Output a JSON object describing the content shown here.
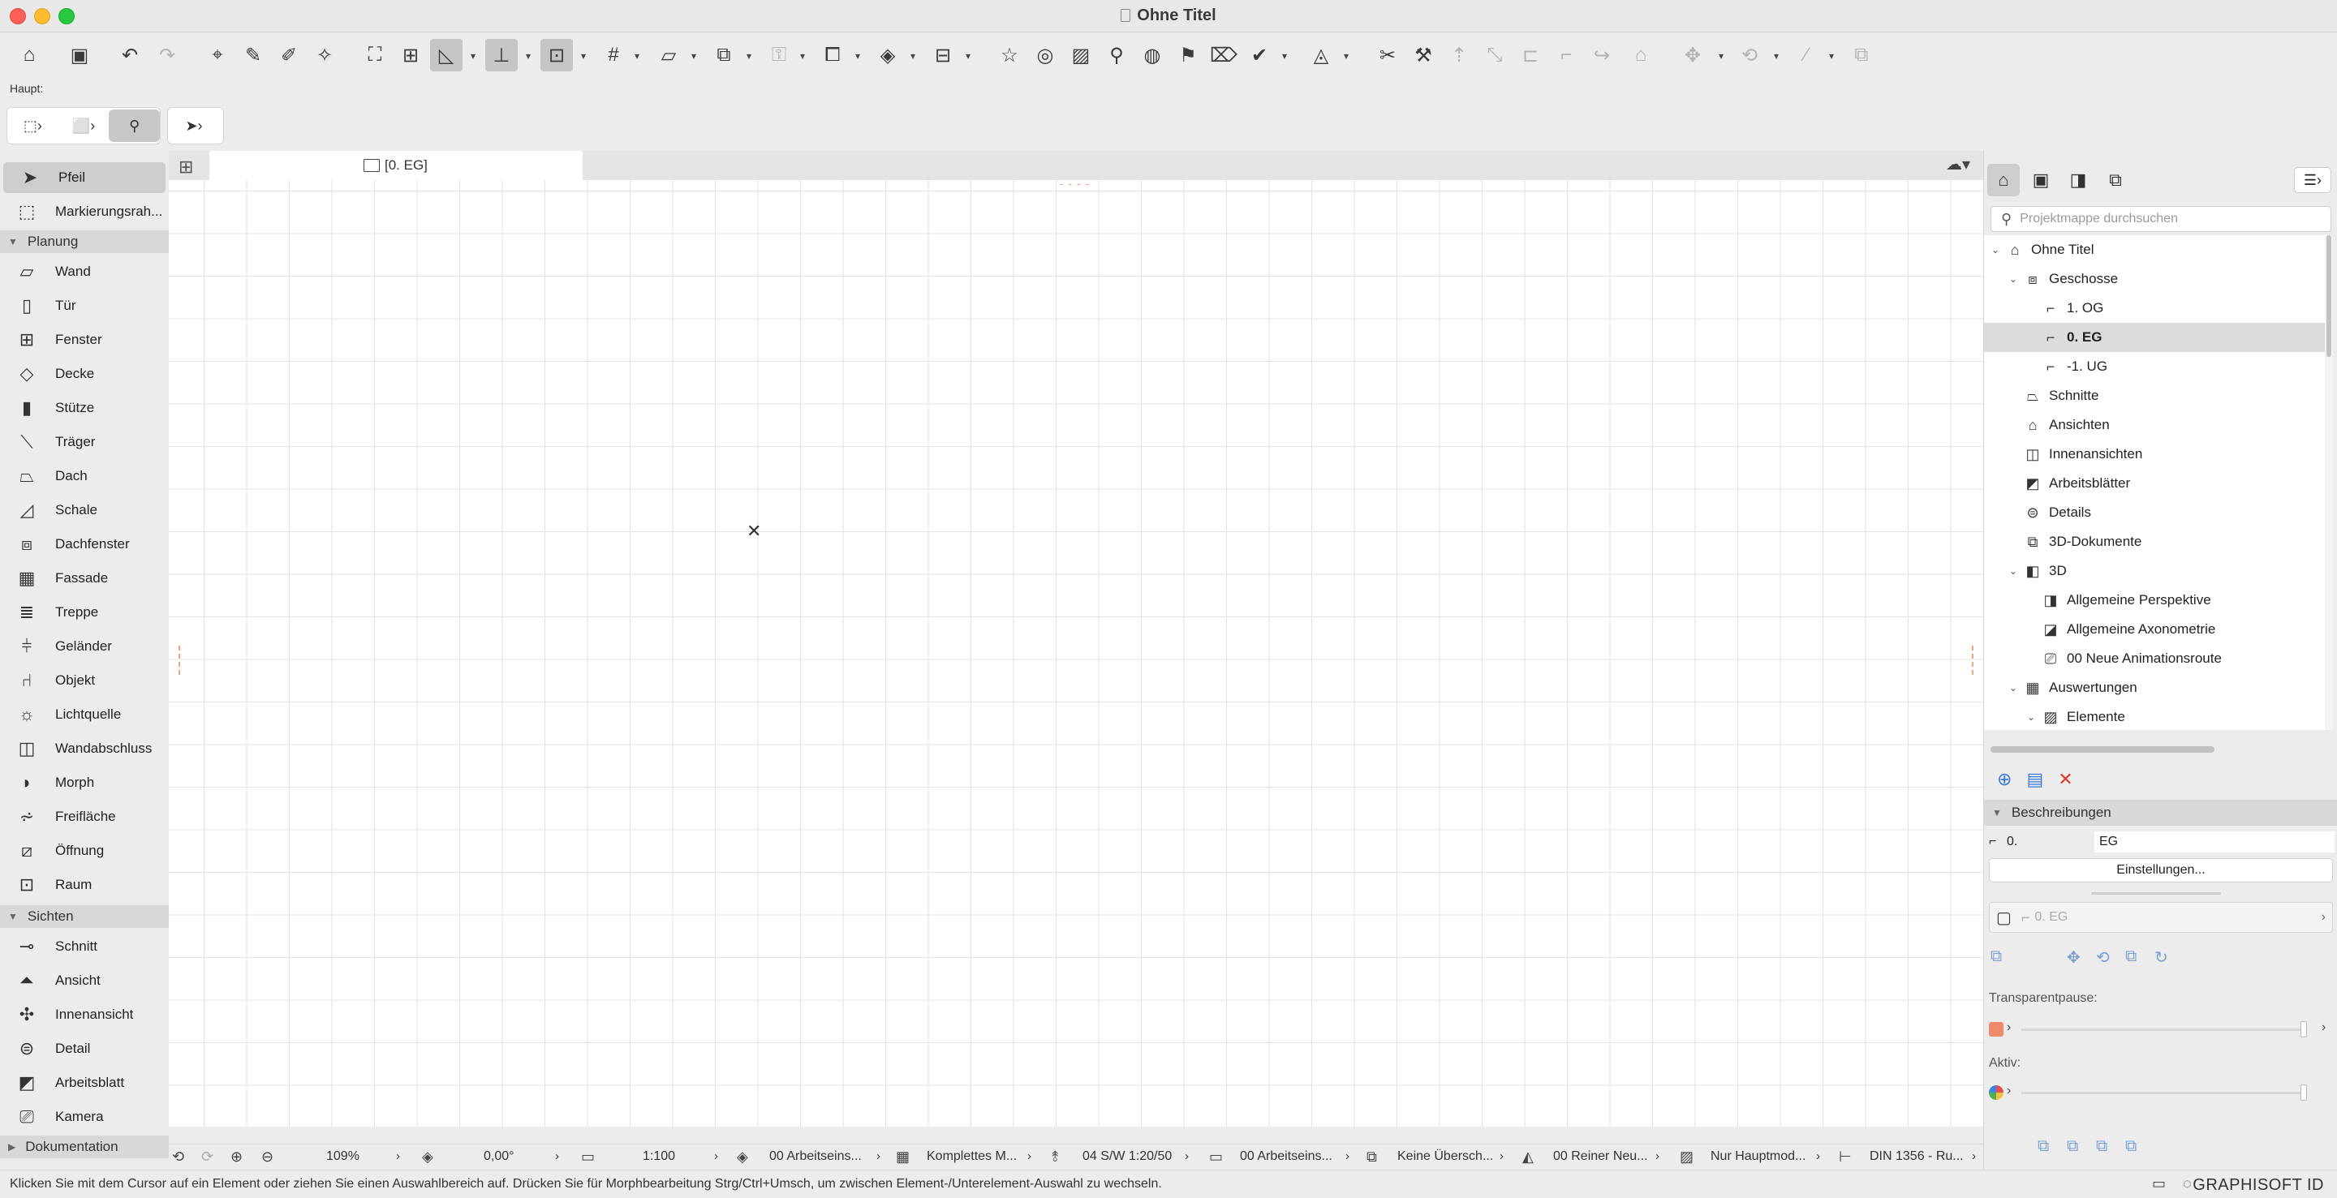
{
  "window": {
    "title": "Ohne Titel"
  },
  "toolbar": {
    "haupt_label": "Haupt:"
  },
  "toolbox": {
    "arrow": "Pfeil",
    "marquee": "Markierungsrah...",
    "sections": {
      "planung": "Planung",
      "sichten": "Sichten",
      "dokumentation": "Dokumentation"
    },
    "planung_tools": [
      "Wand",
      "Tür",
      "Fenster",
      "Decke",
      "Stütze",
      "Träger",
      "Dach",
      "Schale",
      "Dachfenster",
      "Fassade",
      "Treppe",
      "Geländer",
      "Objekt",
      "Lichtquelle",
      "Wandabschluss",
      "Morph",
      "Freifläche",
      "Öffnung",
      "Raum"
    ],
    "sichten_tools": [
      "Schnitt",
      "Ansicht",
      "Innenansicht",
      "Detail",
      "Arbeitsblatt",
      "Kamera"
    ]
  },
  "canvas": {
    "tab_label": "[0. EG]"
  },
  "controlbar": {
    "zoom": "109%",
    "angle": "0,00°",
    "scale": "1:100",
    "layer_combo": "00 Arbeitseins...",
    "model_view": "Komplettes M...",
    "pen_set": "04 S/W 1:20/50",
    "layer_combo2": "00 Arbeitseins...",
    "override": "Keine Übersch...",
    "renovation": "00 Reiner Neu...",
    "structure": "Nur Hauptmod...",
    "dimension": "DIN 1356 - Ru..."
  },
  "statusbar": {
    "message": "Klicken Sie mit dem Cursor auf ein Element oder ziehen Sie einen Auswahlbereich auf. Drücken Sie für Morphbearbeitung Strg/Ctrl+Umsch, um zwischen Element-/Unterelement-Auswahl zu wechseln.",
    "brand": "GRAPHISOFT ID"
  },
  "navigator": {
    "search_placeholder": "Projektmappe durchsuchen",
    "tree": {
      "root": "Ohne Titel",
      "geschosse": "Geschosse",
      "og1": "1. OG",
      "eg0": "0. EG",
      "ug1": "-1. UG",
      "schnitte": "Schnitte",
      "ansichten": "Ansichten",
      "innenansichten": "Innenansichten",
      "arbeitsblaetter": "Arbeitsblätter",
      "details": "Details",
      "dok3d": "3D-Dokumente",
      "d3": "3D",
      "perspektive": "Allgemeine Perspektive",
      "axonometrie": "Allgemeine Axonometrie",
      "animation": "00 Neue Animationsroute",
      "auswertungen": "Auswertungen",
      "elemente": "Elemente"
    },
    "descriptions_header": "Beschreibungen",
    "desc_number": "0.",
    "desc_name": "EG",
    "settings_button": "Einstellungen...",
    "layer_row_label": "0. EG",
    "transparency_label": "Transparentpause:",
    "active_label": "Aktiv:",
    "colors": {
      "transparency_swatch": "#f08a6c",
      "accent_blue": "#3b78d8",
      "delete_red": "#e03a2e"
    }
  }
}
